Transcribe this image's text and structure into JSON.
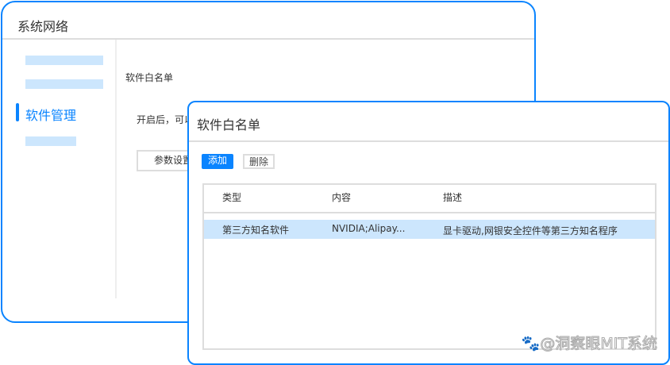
{
  "background_window": {
    "title": "系统网络",
    "sidebar": {
      "active_item": "软件管理"
    },
    "content": {
      "section_title": "软件白名单",
      "description": "开启后，可以",
      "params_button": "参数设置"
    }
  },
  "dialog": {
    "title": "软件白名单",
    "add_button": "添加",
    "delete_button": "删除",
    "columns": [
      "类型",
      "内容",
      "描述"
    ],
    "rows": [
      {
        "type": "第三方知名软件",
        "content": "NVIDIA;Alipay...",
        "description": "显卡驱动,网银安全控件等第三方知名程序",
        "selected": true
      }
    ]
  },
  "watermark": "@洞察眼MIT系统",
  "colors": {
    "accent": "#0a84ff",
    "selected_row": "#cce6fd",
    "placeholder": "#cce6fd"
  }
}
